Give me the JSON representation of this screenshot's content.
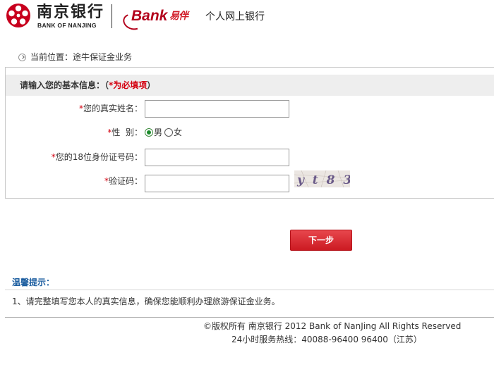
{
  "header": {
    "bank_name_cn": "南京银行",
    "bank_name_en": "BANK OF NANJING",
    "ebank_logo_text": "Bank",
    "ebank_logo_cn": "易伴",
    "site_title": "个人网上银行"
  },
  "breadcrumb": {
    "icon": "circle-chevron-right-icon",
    "text": "当前位置：途牛保证金业务"
  },
  "form": {
    "title_prefix": "请输入您的基本信息：（",
    "title_required": "*为必填项",
    "title_suffix": "）",
    "required_mark": "*",
    "name_label": "您的真实姓名：",
    "name_value": "",
    "gender_label": "性  别：",
    "gender_options": [
      {
        "label": "男",
        "checked": true
      },
      {
        "label": "女",
        "checked": false
      }
    ],
    "id_label": "您的18位身份证号码：",
    "id_value": "",
    "captcha_label": "验证码：",
    "captcha_value": "",
    "captcha_image_text": "y t 8 3"
  },
  "next_button": {
    "label": "下一步"
  },
  "tips": {
    "title": "温馨提示：",
    "items": [
      "1、请完整填写您本人的真实信息，确保您能顺利办理旅游保证金业务。"
    ]
  },
  "footer": {
    "copyright": "©版权所有 南京银行 2012 Bank of NanJing All Rights Reserved",
    "hotline": "24小时服务热线：40088-96400 96400（江苏）"
  },
  "colors": {
    "brand_red": "#b3001b",
    "button_red": "#d9252c",
    "required_red": "#d4000f",
    "tips_blue": "#1d5ea0",
    "panel_header_gray": "#eeeeee"
  }
}
